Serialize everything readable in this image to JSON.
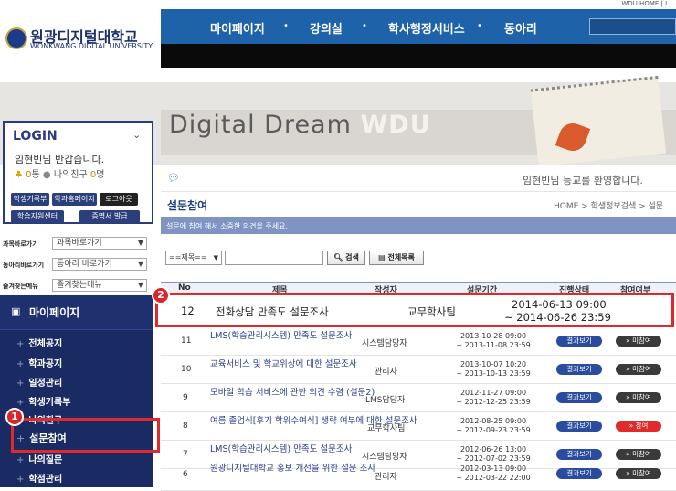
{
  "header": {
    "logo_kr": "원광디지털대학교",
    "logo_en": "WONKWANG DIGITAL UNIVERSITY",
    "top_links": "WDU HOME | L",
    "nav": [
      "마이페이지",
      "강의실",
      "학사행정서비스",
      "동아리"
    ]
  },
  "hero": {
    "text_a": "Digital Dream ",
    "text_b": "WDU"
  },
  "login": {
    "title": "LOGIN",
    "welcome": "임현빈님 반갑습니다.",
    "points_count": "0",
    "points_unit": "통",
    "friends_label": "나의친구",
    "friends_count": "0",
    "friends_unit": "명",
    "buttons": [
      "학생기록부",
      "학과홈페이지",
      "로그아웃",
      "학습지원센터",
      "증명서 발급"
    ]
  },
  "shortcuts": [
    {
      "label": "과목바로가기",
      "value": "과목바로가기"
    },
    {
      "label": "동아리바로가기",
      "value": "동아리 바로가기"
    },
    {
      "label": "즐겨찾는메뉴",
      "value": "즐겨찾는메뉴"
    }
  ],
  "sidebar": {
    "title": "마이페이지",
    "items": [
      "전체공지",
      "학과공지",
      "일정관리",
      "학생기록부",
      "나의친구",
      "설문참여",
      "나의질문",
      "학점관리"
    ]
  },
  "badges": [
    "1",
    "2"
  ],
  "content": {
    "greeting": "임현빈님 등교를 환영합니다.",
    "page_title": "설문참여",
    "breadcrumb": "HOME > 학생정보검색 > 설문",
    "info": "설문에 참여 해서 소중한 의견을 주세요.",
    "search": {
      "select_value": "==제목==",
      "search_btn": "검색",
      "list_btn": "전체목록"
    },
    "columns": [
      "No",
      "제목",
      "작성자",
      "설문기간",
      "진행상태",
      "참여여부"
    ],
    "rows": [
      {
        "no": "12",
        "title": "전화상담 만족도 설문조사",
        "author": "교무학사팀",
        "start": "2014-06-13 09:00",
        "end": "~ 2014-06-26 23:59",
        "status": "",
        "part": ""
      },
      {
        "no": "11",
        "title": "LMS(학습관리시스템) 만족도 설문조사",
        "author": "시스템담당자",
        "start": "2013-10-28 09:00",
        "end": "~ 2013-11-08 23:59",
        "status": "결과보기",
        "part": "» 미참여"
      },
      {
        "no": "10",
        "title": "교육서비스 및 학교위상에 대한 설문조사",
        "author": "관리자",
        "start": "2013-10-07 10:20",
        "end": "~ 2013-10-13 23:59",
        "status": "결과보기",
        "part": "» 미참여"
      },
      {
        "no": "9",
        "title": "모바일 학습 서비스에 관한 의견 수렴 (설문2)",
        "author": "LMS담당자",
        "start": "2012-11-27 09:00",
        "end": "~ 2012-12-25 23:59",
        "status": "결과보기",
        "part": "» 미참여"
      },
      {
        "no": "8",
        "title": "여름 졸업식[후기 학위수여식] 생략 여부에 대한 설문조사",
        "author": "교무학사팀",
        "start": "2012-08-25 09:00",
        "end": "~ 2012-09-23 23:59",
        "status": "결과보기",
        "part": "» 참여"
      },
      {
        "no": "7",
        "title": "LMS(학습관리시스템) 만족도 설문조사",
        "author": "시스템담당자",
        "start": "2012-06-26 13:00",
        "end": "~ 2012-07-02 23:59",
        "status": "결과보기",
        "part": "» 미참여"
      },
      {
        "no": "6",
        "title": "원광디지털대학교 홍보 개선을 위한 설문 조사",
        "author": "관리자",
        "start": "2012-03-13 09:00",
        "end": "~ 2012-03-22 22:00",
        "status": "결과보기",
        "part": "» 미참여"
      }
    ]
  }
}
